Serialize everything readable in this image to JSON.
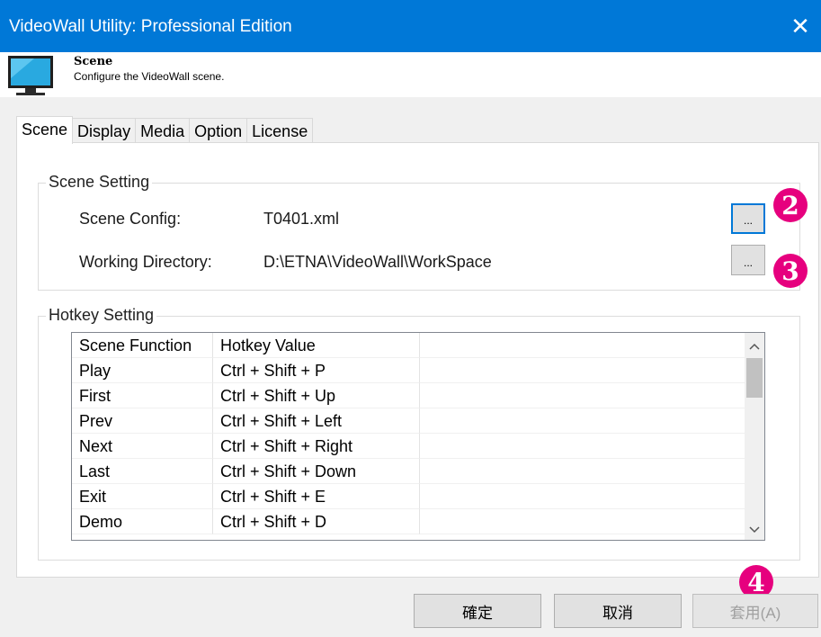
{
  "window": {
    "title": "VideoWall Utility: Professional Edition"
  },
  "header": {
    "title": "Scene",
    "subtitle": "Configure the VideoWall scene."
  },
  "tabs": [
    {
      "label": "Scene",
      "active": true
    },
    {
      "label": "Display"
    },
    {
      "label": "Media"
    },
    {
      "label": "Option"
    },
    {
      "label": "License"
    }
  ],
  "scene_setting": {
    "title": "Scene Setting",
    "config_label": "Scene Config:",
    "config_value": "T0401.xml",
    "dir_label": "Working Directory:",
    "dir_value": "D:\\ETNA\\VideoWall\\WorkSpace",
    "browse_label": "..."
  },
  "hotkey_setting": {
    "title": "Hotkey Setting",
    "columns": [
      "Scene Function",
      "Hotkey Value",
      ""
    ],
    "rows": [
      [
        "Play",
        "Ctrl + Shift + P"
      ],
      [
        "First",
        "Ctrl + Shift + Up"
      ],
      [
        "Prev",
        "Ctrl + Shift + Left"
      ],
      [
        "Next",
        "Ctrl + Shift + Right"
      ],
      [
        "Last",
        "Ctrl + Shift + Down"
      ],
      [
        "Exit",
        "Ctrl + Shift + E"
      ],
      [
        "Demo",
        "Ctrl + Shift + D"
      ]
    ]
  },
  "badges": {
    "b2": "2",
    "b3": "3",
    "b4": "4"
  },
  "buttons": {
    "ok": "確定",
    "cancel": "取消",
    "apply": "套用(A)"
  },
  "icons": {
    "close": "close-icon",
    "monitor": "monitor-icon",
    "scroll_up": "chevron-up-icon",
    "scroll_down": "chevron-down-icon"
  },
  "colors": {
    "titlebar": "#0078d7",
    "badge": "#e6007e"
  }
}
